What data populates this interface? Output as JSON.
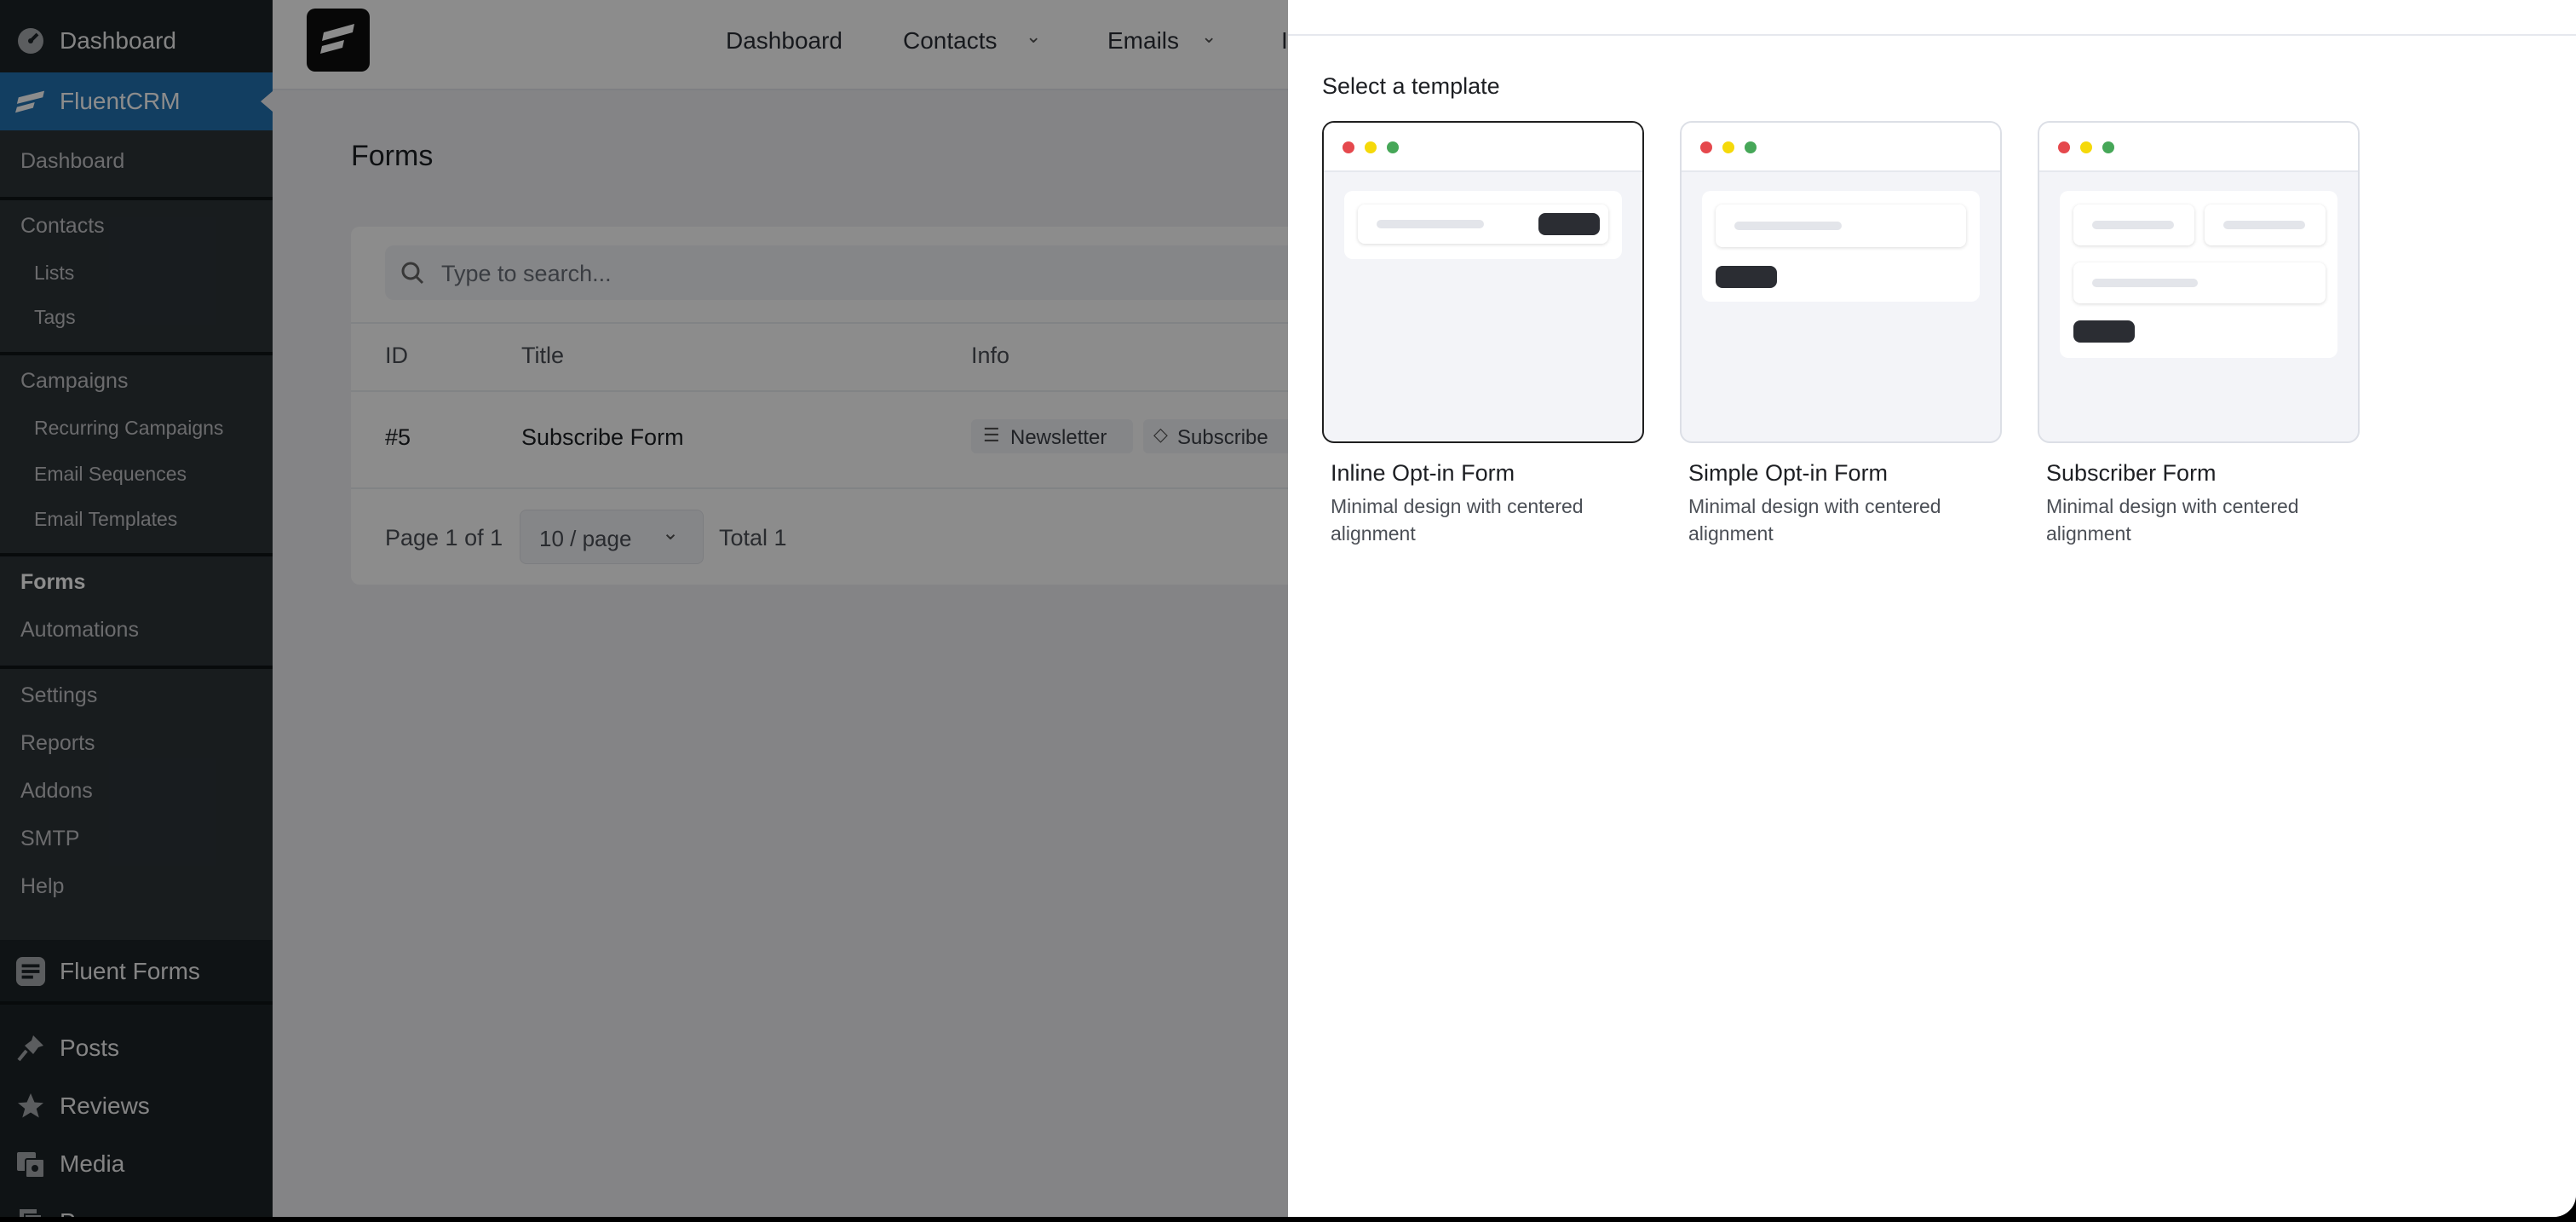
{
  "wp_sidebar": {
    "dashboard": "Dashboard",
    "fluentcrm": "FluentCRM",
    "submenu": {
      "dashboard": "Dashboard",
      "contacts": "Contacts",
      "lists": "Lists",
      "tags": "Tags",
      "campaigns": "Campaigns",
      "recurring_campaigns": "Recurring Campaigns",
      "email_sequences": "Email Sequences",
      "email_templates": "Email Templates",
      "forms": "Forms",
      "automations": "Automations",
      "settings": "Settings",
      "reports": "Reports",
      "addons": "Addons",
      "smtp": "SMTP",
      "help": "Help"
    },
    "fluent_forms": "Fluent Forms",
    "posts": "Posts",
    "reviews": "Reviews",
    "media": "Media",
    "pages": "Pages"
  },
  "topnav": {
    "dashboard": "Dashboard",
    "contacts": "Contacts",
    "emails": "Emails",
    "next_initial": "I"
  },
  "forms_page": {
    "title": "Forms",
    "search_placeholder": "Type to search...",
    "columns": {
      "id": "ID",
      "title": "Title",
      "info": "Info"
    },
    "rows": [
      {
        "id": "#5",
        "title": "Subscribe Form",
        "list": "Newsletter",
        "tag": "Subscribe"
      }
    ],
    "pagination": {
      "page_info": "Page 1 of 1",
      "per_page": "10 / page",
      "total": "Total 1"
    }
  },
  "drawer": {
    "heading": "Select a template",
    "templates": [
      {
        "name": "Inline Opt-in Form",
        "desc": "Minimal design with centered alignment",
        "selected": true
      },
      {
        "name": "Simple Opt-in Form",
        "desc": "Minimal design with centered alignment",
        "selected": false
      },
      {
        "name": "Subscriber Form",
        "desc": "Minimal design with centered alignment",
        "selected": false
      }
    ]
  },
  "colors": {
    "wp_sidebar_bg": "#1d2327",
    "wp_submenu_bg": "#2c3338",
    "wp_active": "#2271b1",
    "dot_red": "#e5484d",
    "dot_yellow": "#f5d90a",
    "dot_green": "#46a758"
  }
}
